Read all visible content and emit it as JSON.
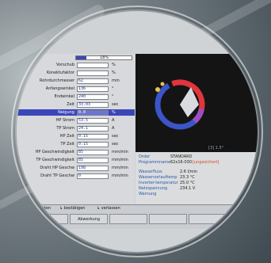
{
  "left_panel": {
    "top_value": "18%",
    "rows": [
      {
        "label": "Vorschub",
        "value": "",
        "unit": "%"
      },
      {
        "label": "Konektufaktor",
        "value": "",
        "unit": "%"
      },
      {
        "label": "Rohrdurchmesser",
        "value": "62",
        "unit": "mm"
      },
      {
        "label": "Anfangswinkel",
        "value": "136",
        "unit": "°"
      },
      {
        "label": "Endwinkel",
        "value": "240",
        "unit": "°"
      },
      {
        "label": "Zeit",
        "value": "33.03",
        "unit": "sec"
      },
      {
        "label": "Neigung",
        "value": "0.0",
        "unit": "%"
      },
      {
        "label": "HP Strom",
        "value": "53.5",
        "unit": "A"
      },
      {
        "label": "TP Strom",
        "value": "24.1",
        "unit": "A"
      },
      {
        "label": "HP Zeit",
        "value": "0.15",
        "unit": "sec"
      },
      {
        "label": "TP Zeit",
        "value": "0.15",
        "unit": "sec"
      },
      {
        "label": "HP Geschwindigkeit",
        "value": "85",
        "unit": "mm/min"
      },
      {
        "label": "TP Geschwindigkeit",
        "value": "85",
        "unit": "mm/min"
      },
      {
        "label": "Draht HP Geschw",
        "value": "198",
        "unit": "mm/min"
      },
      {
        "label": "Draht TP Geschw",
        "value": "0",
        "unit": "mm/min"
      }
    ]
  },
  "right_panel": {
    "arc_label": "[3]  1.5°",
    "order_label": "Order",
    "order_value": "STANDARD",
    "program_label": "Programmname",
    "program_value": "62x16-030",
    "program_status": "[ungesichert]",
    "info": [
      {
        "label": "Wasserfluss",
        "value": "2.6 l/min"
      },
      {
        "label": "Wasservorlauftemp",
        "value": "23.3 °C"
      },
      {
        "label": "Inverter-temperatur",
        "value": "25.0 °C"
      },
      {
        "label": "Netzspannung",
        "value": "234.1 V"
      },
      {
        "label": "Warnung",
        "value": ""
      }
    ]
  },
  "toolbar": {
    "nav_down": "nach unten",
    "confirm": "bestätigen",
    "exit": "verlassen",
    "button": "Abwerkung"
  },
  "colors": {
    "accent": "#3b47b8",
    "arc_red": "#e0353d",
    "arc_blue": "#3b55c8",
    "arc_purple": "#9a4fc4",
    "marker": "#e8c44a"
  }
}
